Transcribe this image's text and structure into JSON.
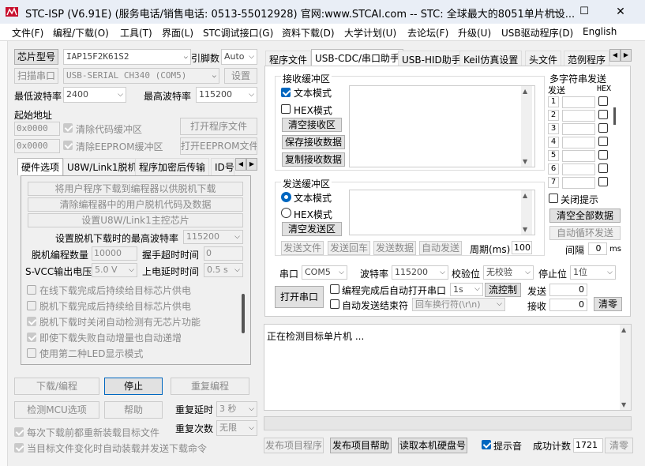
{
  "window": {
    "title": "STC-ISP (V6.91E) (服务电话/销售电话: 0513-55012928) 官网:www.STCAI.com  -- STC: 全球最大的8051单片机设...",
    "min": "—",
    "max": "☐",
    "close": "✕"
  },
  "menu": [
    "文件(F)",
    "编程/下载(O)",
    "工具(T)",
    "界面(L)",
    "STC调试接口(G)",
    "资料下载(D)",
    "大学计划(U)",
    "去论坛(F)",
    "升级(U)",
    "USB驱动程序(D)",
    "English"
  ],
  "left": {
    "chip_model_btn": "芯片型号",
    "chip_model": "IAP15F2K61S2",
    "pin_label": "引脚数",
    "pin_value": "Auto",
    "scan_btn": "扫描串口",
    "port": "USB-SERIAL CH340 (COM5)",
    "settings_btn": "设置",
    "min_baud_label": "最低波特率",
    "min_baud": "2400",
    "max_baud_label": "最高波特率",
    "max_baud": "115200",
    "start_addr_label": "起始地址",
    "addr1": "0x0000",
    "clear_code": "清除代码缓冲区",
    "open_prog_btn": "打开程序文件",
    "addr2": "0x0000",
    "clear_eeprom": "清除EEPROM缓冲区",
    "open_eeprom_btn": "打开EEPROM文件",
    "tabs": [
      "硬件选项",
      "U8W/Link1脱机",
      "程序加密后传输",
      "ID号"
    ],
    "offline": {
      "btn1": "将用户程序下载到编程器以供脱机下载",
      "btn2": "清除编程器中的用户脱机代码及数据",
      "btn3": "设置U8W/Link1主控芯片",
      "max_baud_label": "设置脱机下载时的最高波特率",
      "max_baud": "115200",
      "count_label": "脱机编程数量",
      "count": "10000",
      "timeout_label": "握手超时时间",
      "timeout": "0",
      "vcc_label": "S-VCC输出电压",
      "vcc": "5.0 V",
      "delay_label": "上电延时时间",
      "delay": "0.5 s",
      "opts": [
        "在线下载完成后持续给目标芯片供电",
        "脱机下载完成后持续给目标芯片供电",
        "脱机下载时关闭自动检测有无芯片功能",
        "即使下载失败自动增量也自动递增",
        "使用第二种LED显示模式"
      ]
    },
    "download_btn": "下载/编程",
    "stop_btn": "停止",
    "reprogram_btn": "重复编程",
    "detect_btn": "检测MCU选项",
    "help_btn": "帮助",
    "repeat_delay_label": "重复延时",
    "repeat_delay": "3 秒",
    "repeat_count_label": "重复次数",
    "repeat_count": "无限",
    "reload_each": "每次下载前都重新装载目标文件",
    "auto_reload": "当目标文件变化时自动装载并发送下载命令"
  },
  "right": {
    "tabs": [
      "程序文件",
      "USB-CDC/串口助手",
      "USB-HID助手",
      "Keil仿真设置",
      "头文件",
      "范例程序"
    ],
    "recv": {
      "title": "接收缓冲区",
      "text_mode": "文本模式",
      "hex_mode": "HEX模式",
      "clear_btn": "清空接收区",
      "save_btn": "保存接收数据",
      "copy_btn": "复制接收数据"
    },
    "send": {
      "title": "发送缓冲区",
      "text_mode": "文本模式",
      "hex_mode": "HEX模式",
      "clear_btn": "清空发送区",
      "send_file": "发送文件",
      "send_enter": "发送回车",
      "send_data": "发送数据",
      "auto_send": "自动发送",
      "period_label": "周期(ms)",
      "period": "100"
    },
    "multi": {
      "title": "多字符串发送",
      "send_label": "发送",
      "hex_label": "HEX",
      "rows": [
        "1",
        "2",
        "3",
        "4",
        "5",
        "6",
        "7"
      ],
      "close_tip": "关闭提示",
      "clear_all": "清空全部数据",
      "auto_loop": "自动循环发送",
      "interval_label": "间隔",
      "interval": "0",
      "interval_unit": "ms"
    },
    "serial": {
      "port_label": "串口",
      "port": "COM5",
      "baud_label": "波特率",
      "baud": "115200",
      "parity_label": "校验位",
      "parity": "无校验",
      "stop_label": "停止位",
      "stop": "1位",
      "open_btn": "打开串口",
      "auto_open": "编程完成后自动打开串口",
      "auto_open_delay": "1s",
      "flow_btn": "流控制",
      "auto_end": "自动发送结束符",
      "newline": "回车换行符(\\r\\n)",
      "tx_label": "发送",
      "tx": "0",
      "rx_label": "接收",
      "rx": "0",
      "clear_btn": "清零"
    },
    "log": "正在检测目标单片机 ...",
    "bottom": {
      "publish": "发布项目程序",
      "publish_help": "发布项目帮助",
      "read_disk": "读取本机硬盘号",
      "sound": "提示音",
      "count_label": "成功计数",
      "count": "1721",
      "clear": "清零"
    }
  }
}
